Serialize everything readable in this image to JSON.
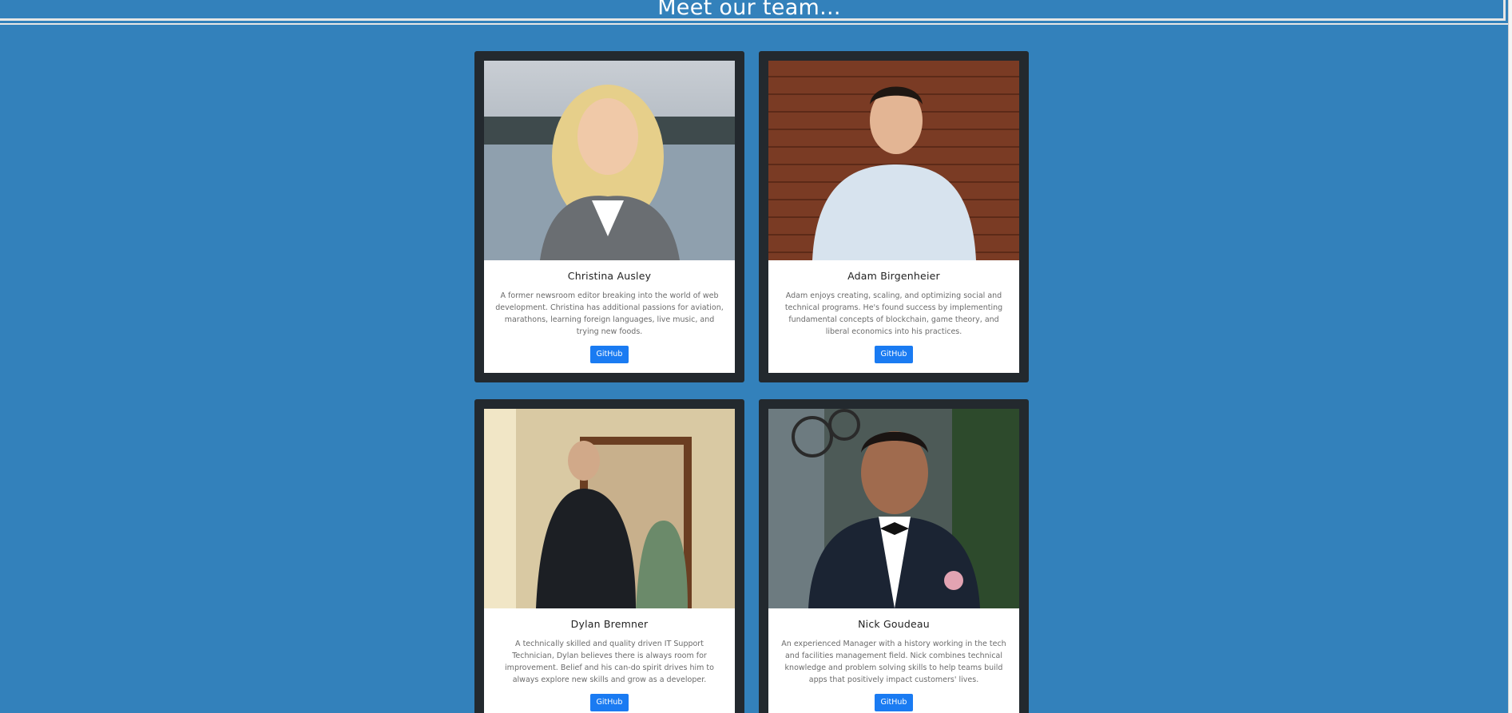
{
  "header": {
    "title": "Meet our team..."
  },
  "team": [
    {
      "name": "Christina Ausley",
      "bio": "A former newsroom editor breaking into the world of web development. Christina has additional passions for aviation, marathons, learning foreign languages, live music, and trying new foods.",
      "button_label": "GitHub"
    },
    {
      "name": "Adam Birgenheier",
      "bio": "Adam enjoys creating, scaling, and optimizing social and technical programs. He's found success by implementing fundamental concepts of blockchain, game theory, and liberal economics into his practices.",
      "button_label": "GitHub"
    },
    {
      "name": "Dylan Bremner",
      "bio": "A technically skilled and quality driven IT Support Technician, Dylan believes there is always room for improvement. Belief and his can-do spirit drives him to always explore new skills and grow as a developer.",
      "button_label": "GitHub"
    },
    {
      "name": "Nick Goudeau",
      "bio": "An experienced Manager with a history working in the tech and facilities management field. Nick combines technical knowledge and problem solving skills to help teams build apps that positively impact customers' lives.",
      "button_label": "GitHub"
    }
  ],
  "colors": {
    "background": "#3381bb",
    "card_frame": "#23292e",
    "button": "#1a7bf2"
  }
}
